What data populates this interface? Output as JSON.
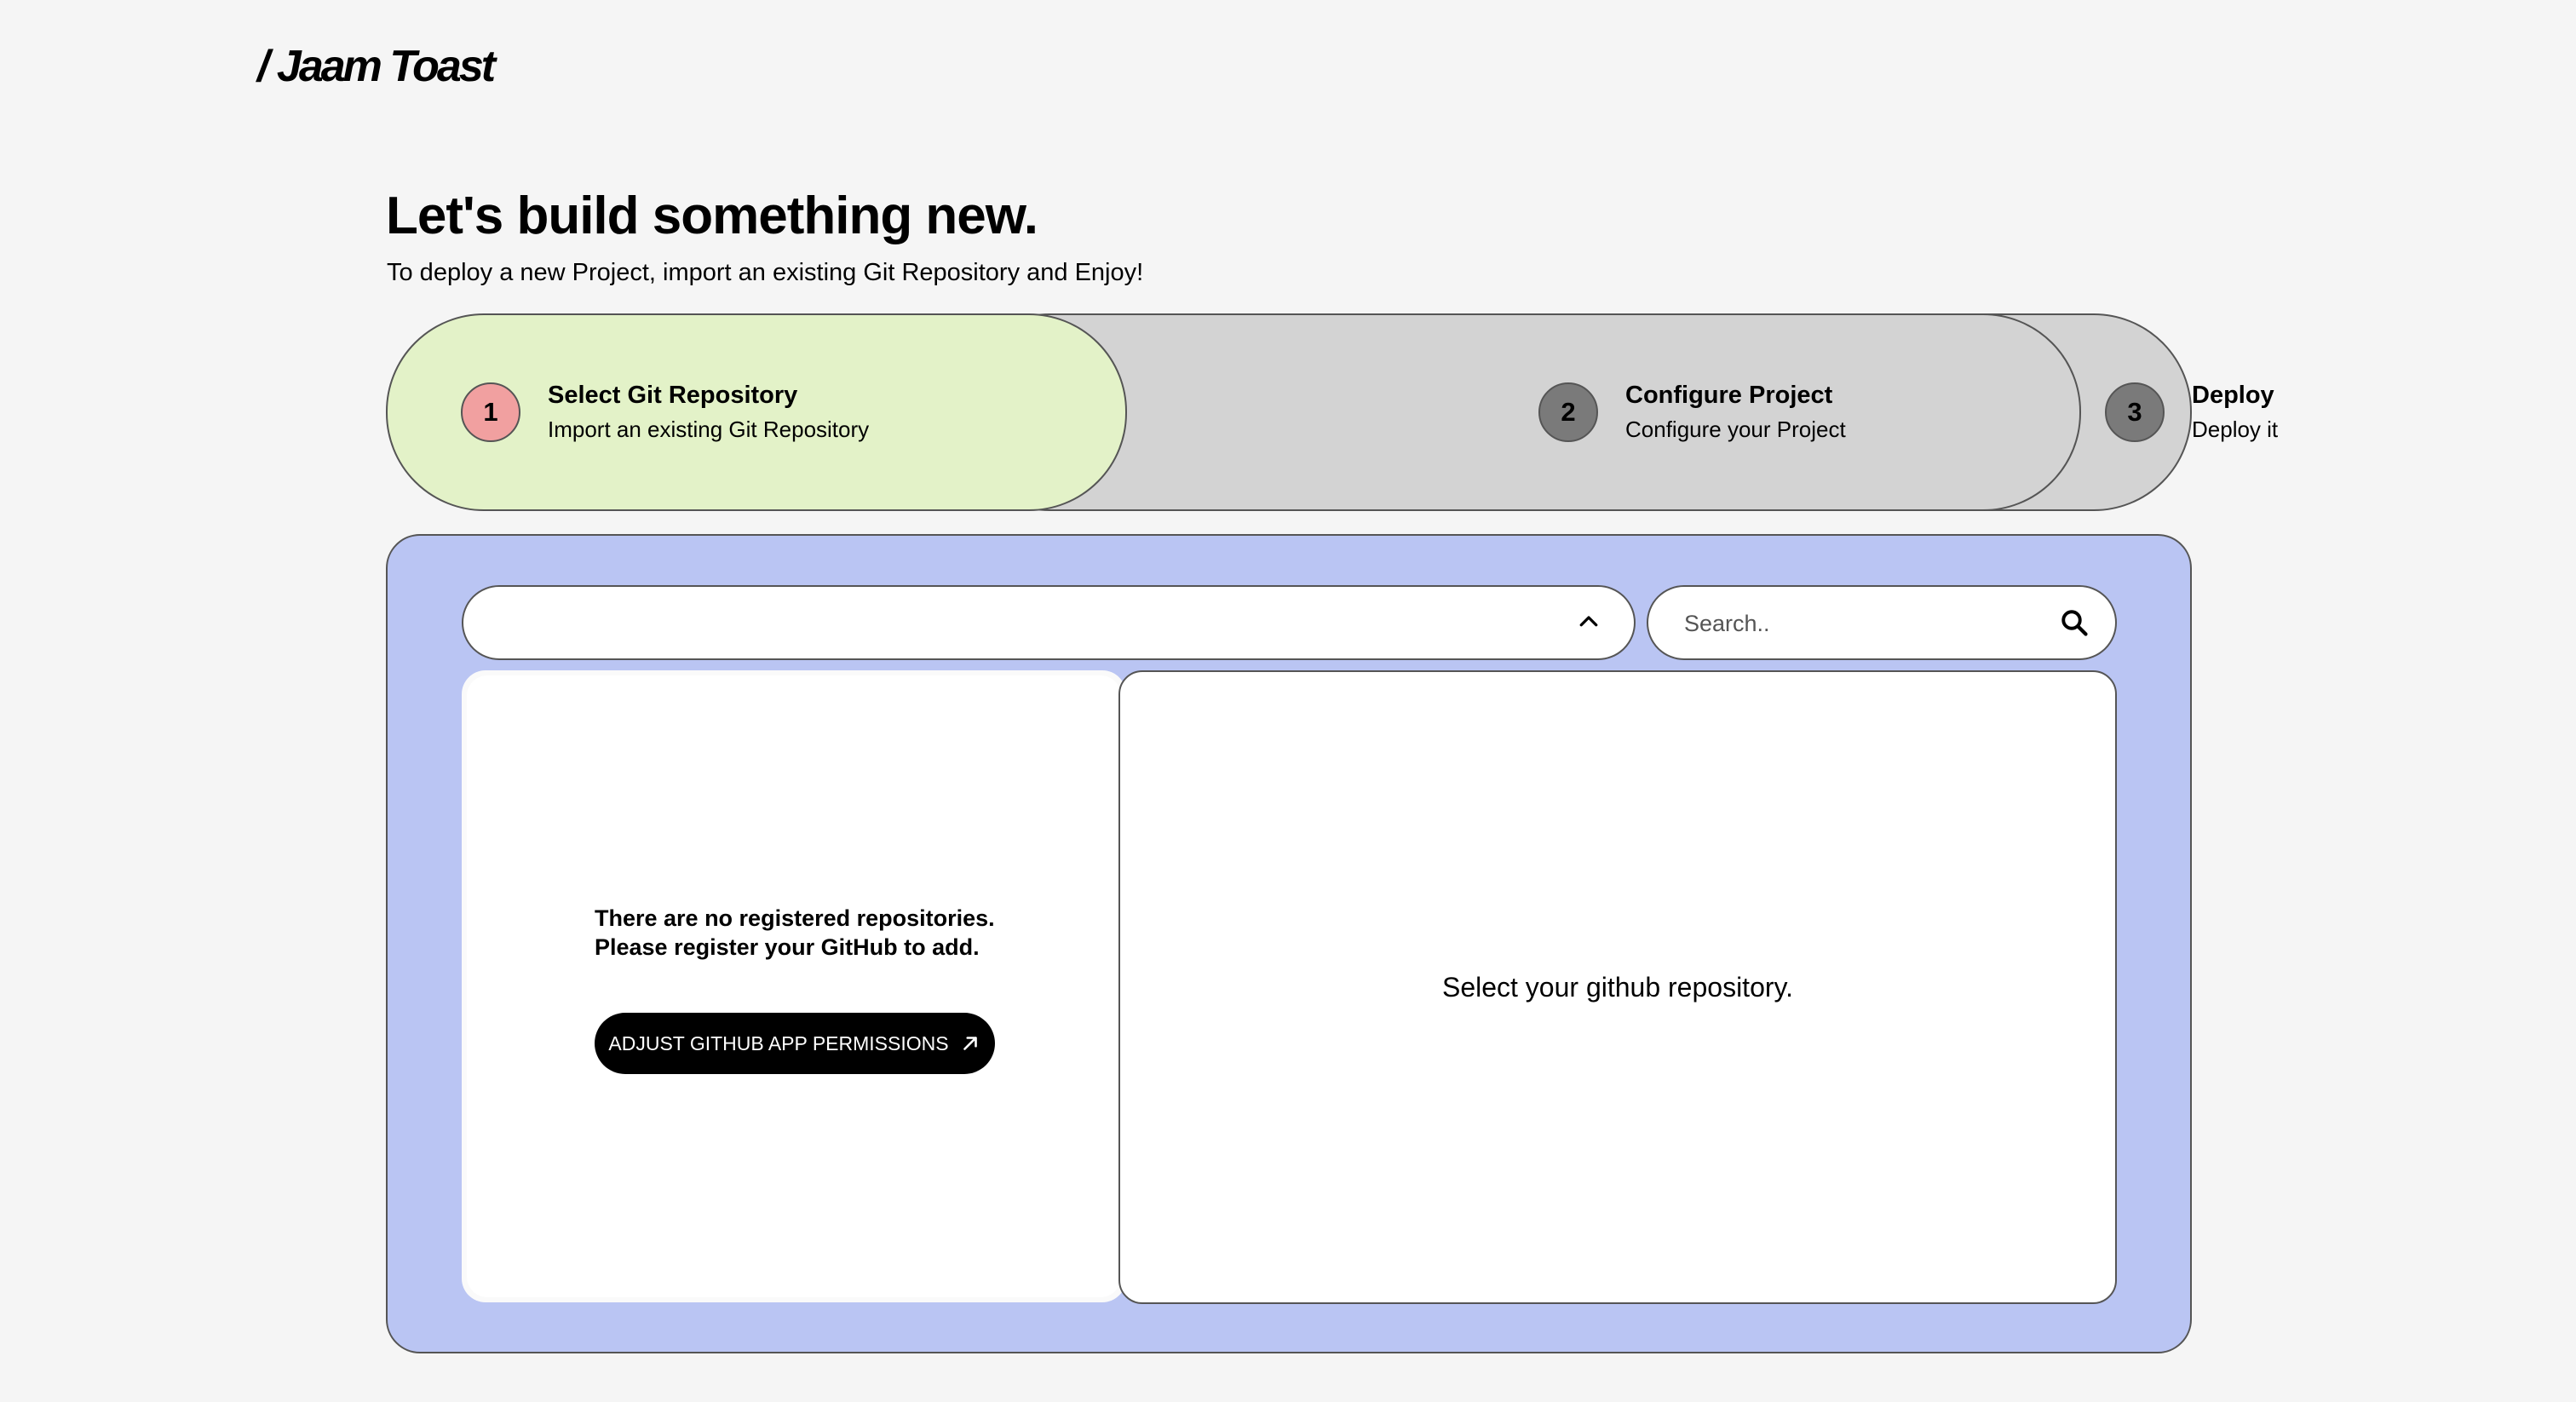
{
  "brand": {
    "logo_text": "/ Jaam Toast"
  },
  "header": {
    "title": "Let's build something new.",
    "subtitle": "To deploy a new Project, import an existing Git Repository and Enjoy!"
  },
  "steps": [
    {
      "number": "1",
      "title": "Select Git Repository",
      "description": "Import an existing Git Repository",
      "active": true
    },
    {
      "number": "2",
      "title": "Configure Project",
      "description": "Configure your Project",
      "active": false
    },
    {
      "number": "3",
      "title": "Deploy",
      "description": "Deploy it",
      "active": false
    }
  ],
  "colors": {
    "active_step_bg": "#e3f2c8",
    "inactive_step_bg": "#d3d3d3",
    "active_step_number_bg": "#f1a0a0",
    "inactive_step_number_bg": "#7a7a7a",
    "panel_bg": "#bac5f3",
    "button_bg": "#000000"
  },
  "repo_selector": {
    "selected_value": "",
    "icon": "chevron-up-icon"
  },
  "search": {
    "placeholder": "Search..",
    "value": "",
    "icon": "search-icon"
  },
  "repositories_panel": {
    "empty_line1": "There are no registered repositories.",
    "empty_line2": "Please register your GitHub to add.",
    "button_label": "ADJUST GITHUB APP PERMISSIONS",
    "button_icon": "arrow-up-right-icon"
  },
  "detail_panel": {
    "message": "Select your github repository."
  }
}
